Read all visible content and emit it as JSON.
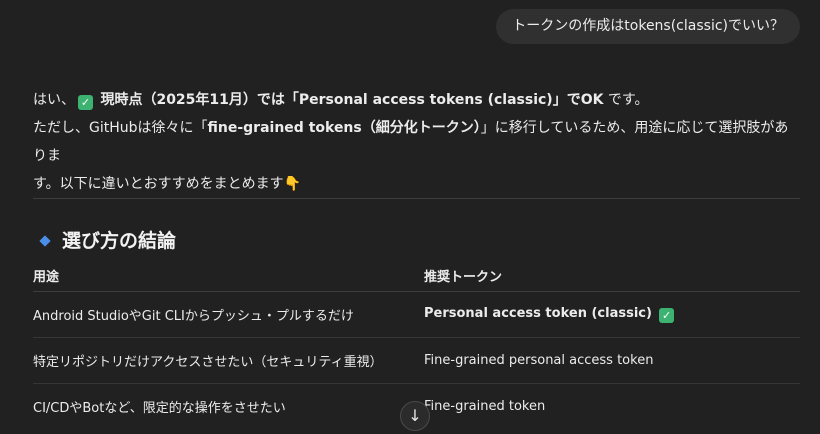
{
  "user_message": "トークンの作成はtokens(classic)でいい？",
  "answer": {
    "line1": {
      "prefix": "はい、",
      "bold": "現時点（2025年11月）では「Personal access tokens (classic)」でOK",
      "suffix": " です。"
    },
    "line2": {
      "prefix": "ただし、GitHubは徐々に「",
      "bold": "fine-grained tokens（細分化トークン）",
      "suffix": "」に移行しているため、用途に応じて選択肢がありま"
    },
    "line3": {
      "text": "す。以下に違いとおすすめをまとめます"
    }
  },
  "section": {
    "title": "選び方の結論"
  },
  "table": {
    "headers": [
      "用途",
      "推奨トークン"
    ],
    "rows": [
      {
        "use": "Android StudioやGit CLIからプッシュ・プルするだけ",
        "token": "Personal access token (classic)",
        "bold": true,
        "check": true
      },
      {
        "use": "特定リポジトリだけアクセスさせたい（セキュリティ重視）",
        "token": "Fine-grained personal access token",
        "bold": false,
        "check": false
      },
      {
        "use": "CI/CDやBotなど、限定的な操作をさせたい",
        "token": "Fine-grained token",
        "bold": false,
        "check": false
      }
    ]
  },
  "icons": {
    "check": "check-mark-icon",
    "hand": "pointing-down-icon",
    "diamond": "blue-diamond-icon",
    "scroll": "arrow-down-icon"
  },
  "colors": {
    "background": "#212121",
    "bubble": "#303030",
    "check_green": "#3cb371",
    "diamond_blue": "#4a8ee8"
  }
}
